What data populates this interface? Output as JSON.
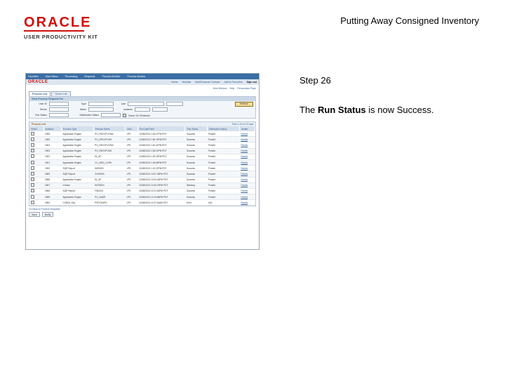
{
  "logo": {
    "brand": "ORACLE",
    "product": "USER PRODUCTIVITY KIT"
  },
  "doc_title": "Putting Away Consigned Inventory",
  "step": "Step 26",
  "instruction": {
    "prefix": "The ",
    "bold": "Run Status",
    "suffix": " is now Success."
  },
  "screenshot": {
    "nav": [
      "Favorites",
      "Main Menu",
      "Processing",
      "Requests",
      "Process Monitor",
      "Process Monitor"
    ],
    "util_links": [
      "Home",
      "Worklist",
      "MultiChannel Console",
      "Add to Favorites",
      "Sign out"
    ],
    "sub_links": [
      "New Window",
      "Help",
      "Personalize Page"
    ],
    "tabs": [
      "Process List",
      "Server List"
    ],
    "panel_title": "View Process Request For",
    "fields": {
      "user": "User ID",
      "type": "Type",
      "server": "Server",
      "name": "Name",
      "run_status": "Run Status",
      "dist_status": "Distribution Status",
      "instance": "Instance",
      "last": "Last",
      "save": "Save On Refresh"
    },
    "refresh_label": "Refresh",
    "list_title": "Process List",
    "list_nav": "First 1-13 of 13 Last",
    "columns": [
      "Select",
      "Instance",
      "Seq.",
      "Process Type",
      "Process Name",
      "User",
      "Run Date/Time",
      "Run Status",
      "Distribution Status",
      "Details"
    ],
    "rows": [
      {
        "inst": "1906",
        "ptype": "Application Engine",
        "pname": "PO_RECVPUTAW",
        "user": "VP1",
        "date": "10/28/2013 1:53:47PM PDT",
        "run": "Success",
        "dist": "Posted",
        "det": "Details"
      },
      {
        "inst": "1905",
        "ptype": "Application Engine",
        "pname": "PO_RECVPUSH",
        "user": "VP1",
        "date": "10/28/2013 1:50:10PM PDT",
        "run": "Success",
        "dist": "Posted",
        "det": "Details"
      },
      {
        "inst": "1904",
        "ptype": "Application Engine",
        "pname": "PO_RECVPUTAW",
        "user": "VP1",
        "date": "10/28/2013 1:40:41PM PDT",
        "run": "Success",
        "dist": "Posted",
        "det": "Details"
      },
      {
        "inst": "1903",
        "ptype": "Application Engine",
        "pname": "PO_RECVPUSH",
        "user": "VP1",
        "date": "10/28/2013 1:35:22PM PDT",
        "run": "Success",
        "dist": "Posted",
        "det": "Details"
      },
      {
        "inst": "1902",
        "ptype": "Application Engine",
        "pname": "IN_UP",
        "user": "VP1",
        "date": "10/28/2013 1:25:15PM PDT",
        "run": "Success",
        "dist": "Posted",
        "det": "Details"
      },
      {
        "inst": "1901",
        "ptype": "Application Engine",
        "pname": "CC_MSG_CLRS",
        "user": "VP1",
        "date": "10/28/2013 1:18:58PM PDT",
        "run": "Success",
        "dist": "Posted",
        "det": "Details"
      },
      {
        "inst": "1900",
        "ptype": "SQR Report",
        "pname": "INS9000",
        "user": "VP1",
        "date": "10/28/2013 1:10:22PM PDT",
        "run": "Success",
        "dist": "Posted",
        "det": "Details"
      },
      {
        "inst": "1899",
        "ptype": "SQR Report",
        "pname": "CLR0500",
        "user": "VP1",
        "date": "10/28/2013 12:57:39PM PDT",
        "run": "Success",
        "dist": "Posted",
        "det": "Details"
      },
      {
        "inst": "1898",
        "ptype": "Application Engine",
        "pname": "IN_UP",
        "user": "VP1",
        "date": "10/28/2013 12:51:24PM PDT",
        "run": "Success",
        "dist": "Posted",
        "det": "Details"
      },
      {
        "inst": "1897",
        "ptype": "nVision",
        "pname": "NVSRUN",
        "user": "VP1",
        "date": "10/28/2013 12:40:19PM PDT",
        "run": "Warning",
        "dist": "Posted",
        "det": "Details"
      },
      {
        "inst": "1896",
        "ptype": "SQR Report",
        "pname": "FIN0001",
        "user": "VP1",
        "date": "10/28/2013 12:31:52PM PDT",
        "run": "Success",
        "dist": "Posted",
        "det": "Details"
      },
      {
        "inst": "1895",
        "ptype": "Application Engine",
        "pname": "PO_ADDR",
        "user": "VP1",
        "date": "10/28/2013 12:10:56PM PDT",
        "run": "Success",
        "dist": "Posted",
        "det": "Details"
      },
      {
        "inst": "1894",
        "ptype": "COBOL SQL",
        "pname": "PSPCKUPD",
        "user": "VP1",
        "date": "10/28/2013 11:57:34AM PDT",
        "run": "Error",
        "dist": "N/A",
        "det": "Details"
      }
    ],
    "go_back": "Go back to Process Requests",
    "buttons": [
      "Save",
      "Notify"
    ]
  }
}
